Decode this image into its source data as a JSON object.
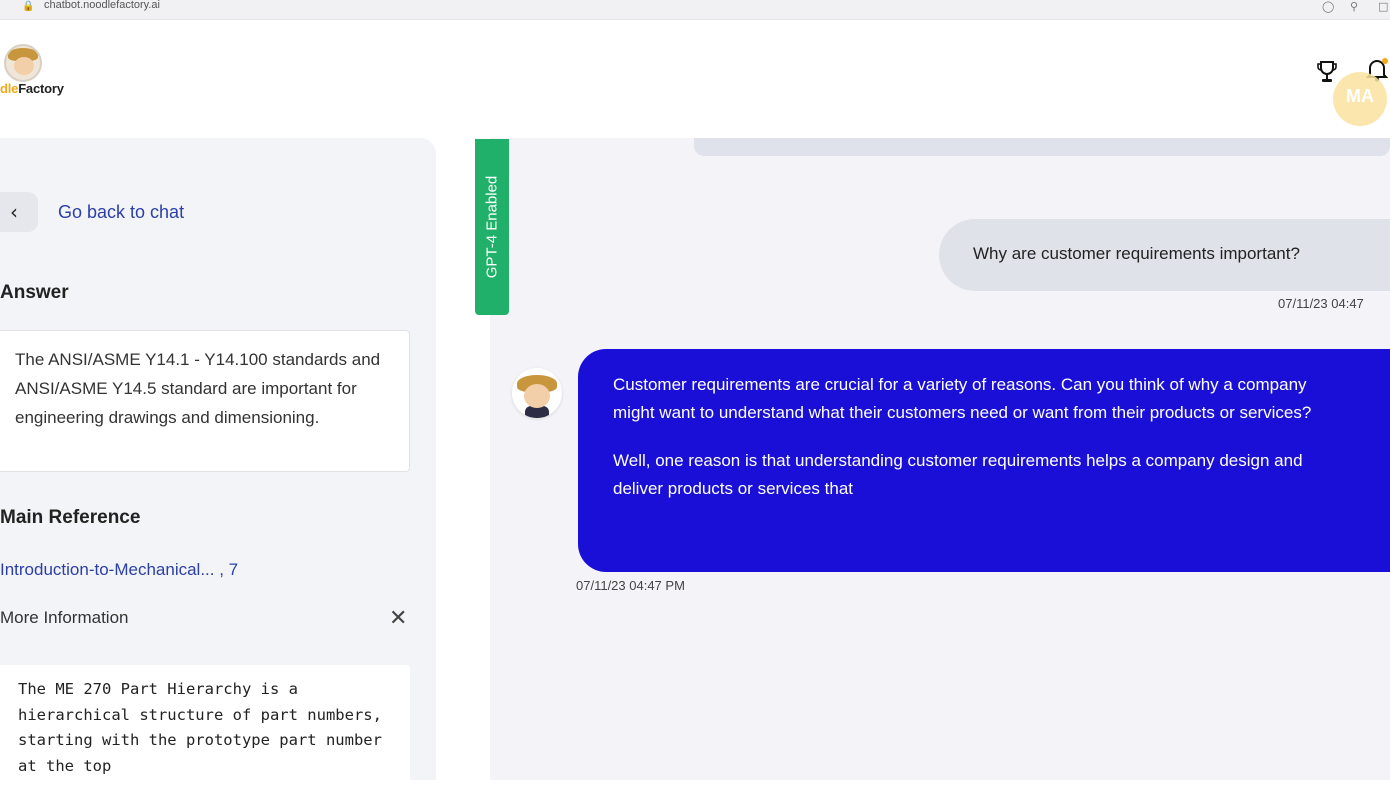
{
  "browser": {
    "url": "chatbot.noodlefactory.ai"
  },
  "header": {
    "logo_prefix": "dle",
    "logo_suffix": "Factory",
    "avatar_initials": "MA",
    "icons": [
      "trophy-icon",
      "bell-icon"
    ]
  },
  "sidebar": {
    "back_label": "Go back to chat",
    "answer_heading": "Answer",
    "answer_text": "The ANSI/ASME Y14.1 - Y14.100 standards and ANSI/ASME Y14.5 standard are important for engineering drawings and dimensioning.",
    "main_reference_heading": "Main Reference",
    "reference_link": "Introduction-to-Mechanical... , 7",
    "more_info_heading": "More Information",
    "more_info_text": "The ME 270 Part Hierarchy is a hierarchical structure of part numbers, starting with the prototype part number at the top"
  },
  "gpt_badge": "GPT-4 Enabled",
  "chat": {
    "user_message": "Why are customer requirements important?",
    "user_time": "07/11/23 04:47",
    "bot_paragraphs": [
      "Customer requirements are crucial for a variety of reasons. Can you think of why a company might want to understand what their customers need or want from their products or services?",
      "Well, one reason is that understanding customer requirements helps a company design and deliver products or services that"
    ],
    "bot_time": "07/11/23 04:47 PM"
  },
  "colors": {
    "bot_bubble": "#1a0fd6",
    "gpt_badge": "#20b06a",
    "link": "#2b3fa6",
    "logo_accent": "#f3a91e"
  }
}
